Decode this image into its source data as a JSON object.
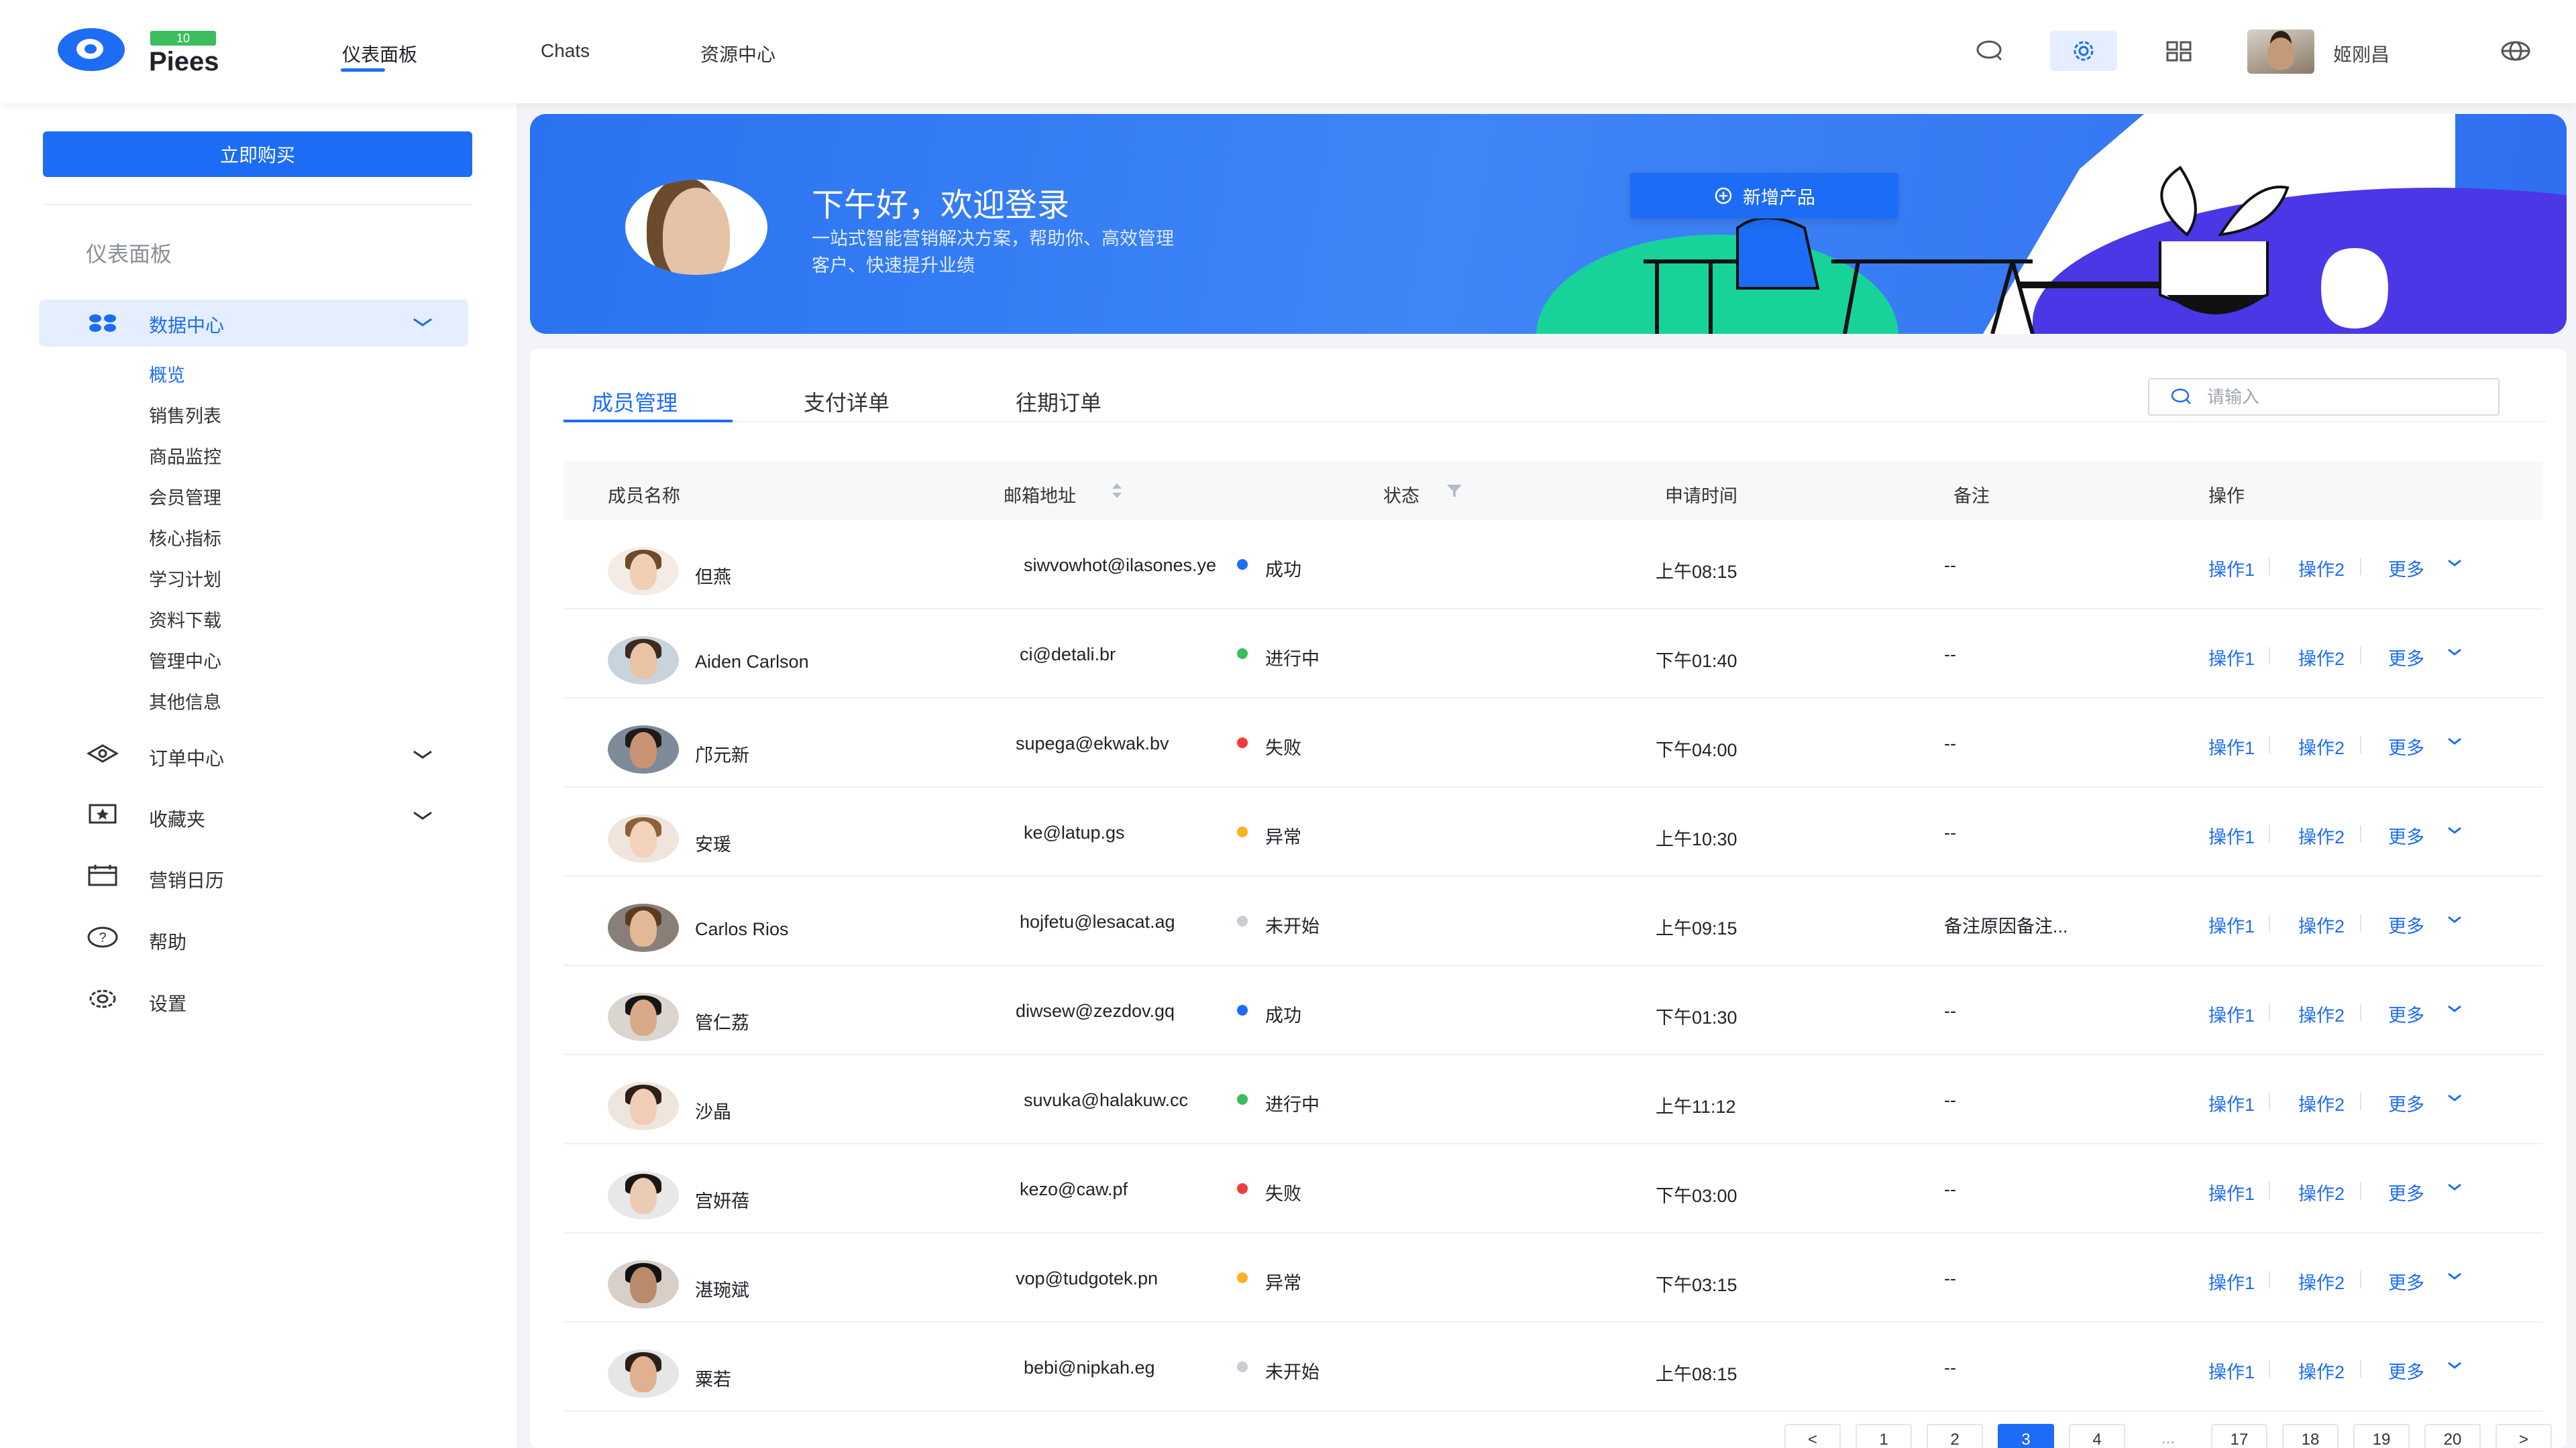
{
  "brand": {
    "name": "Piees",
    "badge": "10"
  },
  "topnav": {
    "items": [
      "仪表面板",
      "Chats",
      "资源中心"
    ],
    "active": 0
  },
  "topbar": {
    "user_name": "姬刚昌",
    "icons": [
      "search-icon",
      "settings-icon",
      "grid-icon",
      "globe-icon"
    ]
  },
  "sidebar": {
    "buy_label": "立即购买",
    "section_title": "仪表面板",
    "active_group": "数据中心",
    "sub_items": [
      "概览",
      "销售列表",
      "商品监控",
      "会员管理",
      "核心指标",
      "学习计划",
      "资料下载",
      "管理中心",
      "其他信息"
    ],
    "menu": [
      {
        "label": "订单中心",
        "icon": "ticket-icon",
        "expandable": true
      },
      {
        "label": "收藏夹",
        "icon": "star-icon",
        "expandable": true
      },
      {
        "label": "营销日历",
        "icon": "calendar-icon",
        "expandable": false
      },
      {
        "label": "帮助",
        "icon": "help-icon",
        "expandable": false
      },
      {
        "label": "设置",
        "icon": "gear-icon",
        "expandable": false
      }
    ]
  },
  "banner": {
    "title": "下午好，欢迎登录",
    "desc_line1": "一站式智能营销解决方案，帮助你、高效管理",
    "desc_line2": "客户、快速提升业绩",
    "add_button": "新增产品"
  },
  "tabs": [
    "成员管理",
    "支付详单",
    "往期订单"
  ],
  "search": {
    "placeholder": "请输入"
  },
  "table": {
    "headers": [
      "成员名称",
      "邮箱地址",
      "状态",
      "申请时间",
      "备注",
      "操作"
    ],
    "rows": [
      {
        "name": "但燕",
        "email": "siwvowhot@ilasones.ye",
        "status": "成功",
        "time": "上午08:15",
        "note": "--"
      },
      {
        "name": "Aiden Carlson",
        "email": "ci@detali.br",
        "status": "进行中",
        "time": "下午01:40",
        "note": "--"
      },
      {
        "name": "邝元新",
        "email": "supega@ekwak.bv",
        "status": "失败",
        "time": "下午04:00",
        "note": "--"
      },
      {
        "name": "安瑗",
        "email": "ke@latup.gs",
        "status": "异常",
        "time": "上午10:30",
        "note": "--"
      },
      {
        "name": "Carlos Rios",
        "email": "hojfetu@lesacat.ag",
        "status": "未开始",
        "time": "上午09:15",
        "note": "备注原因备注..."
      },
      {
        "name": "管仁荔",
        "email": "diwsew@zezdov.gq",
        "status": "成功",
        "time": "下午01:30",
        "note": "--"
      },
      {
        "name": "沙晶",
        "email": "suvuka@halakuw.cc",
        "status": "进行中",
        "time": "上午11:12",
        "note": "--"
      },
      {
        "name": "宫妍蓓",
        "email": "kezo@caw.pf",
        "status": "失败",
        "time": "下午03:00",
        "note": "--"
      },
      {
        "name": "湛琬斌",
        "email": "vop@tudgotek.pn",
        "status": "异常",
        "time": "下午03:15",
        "note": "--"
      },
      {
        "name": "粟若",
        "email": "bebi@nipkah.eg",
        "status": "未开始",
        "time": "上午08:15",
        "note": "--"
      }
    ],
    "actions": [
      "操作1",
      "操作2",
      "更多"
    ]
  },
  "status_colors": {
    "成功": "#1d6cf5",
    "进行中": "#3bbd5b",
    "失败": "#f23b3b",
    "异常": "#ffb020",
    "未开始": "#c9cdd4"
  },
  "pagination": {
    "prev": "<",
    "next": ">",
    "pages": [
      "1",
      "2",
      "3",
      "4",
      "...",
      "17",
      "18",
      "19",
      "20"
    ],
    "current": "3"
  }
}
